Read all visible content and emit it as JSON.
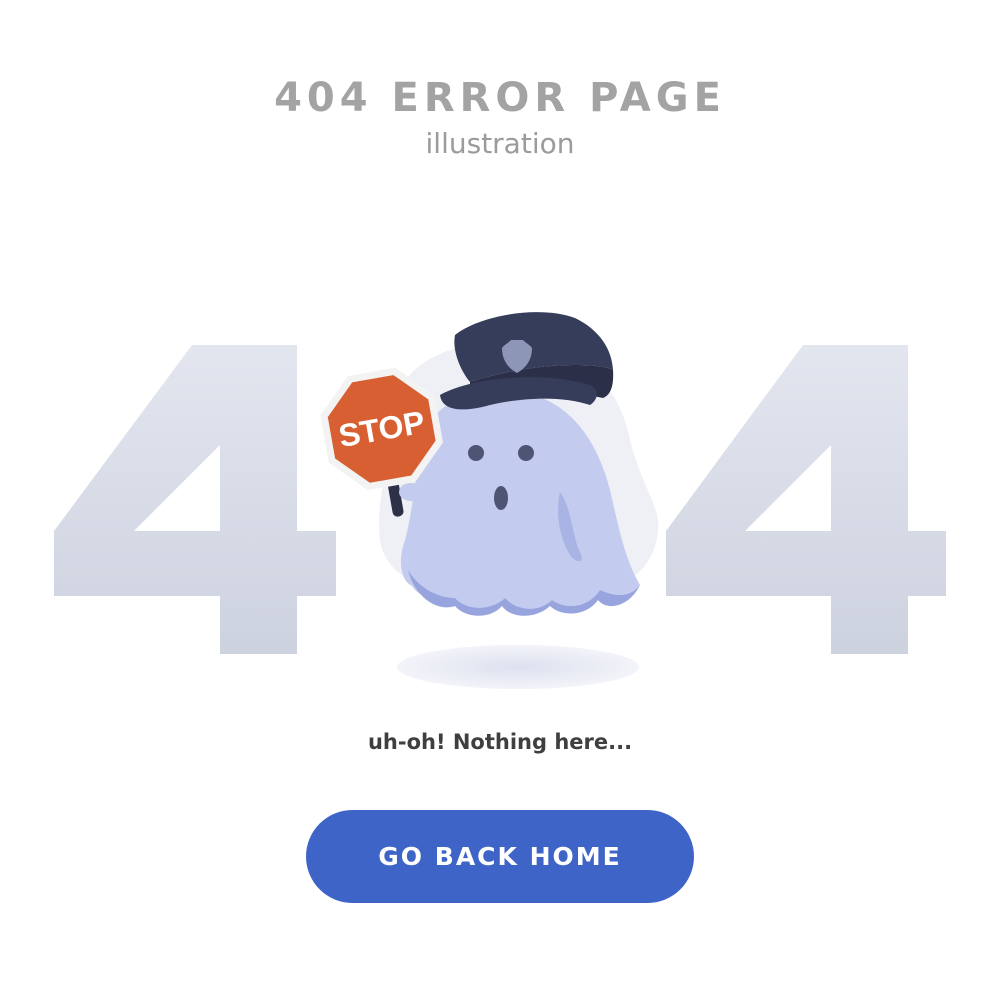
{
  "header": {
    "title": "404 ERROR PAGE",
    "subtitle": "illustration"
  },
  "illustration": {
    "digit_left": "4",
    "digit_right": "4",
    "sign_text": "STOP",
    "colors": {
      "digits": "#d7dbe6",
      "ghost_body": "#c3cbee",
      "ghost_shadow": "#98a4dd",
      "cap": "#363d5a",
      "badge": "#8e96b8",
      "sign": "#d75f32",
      "sign_text": "#ffffff"
    }
  },
  "message": "uh-oh! Nothing here...",
  "button": {
    "label": "GO BACK HOME",
    "color": "#3e64c7"
  }
}
